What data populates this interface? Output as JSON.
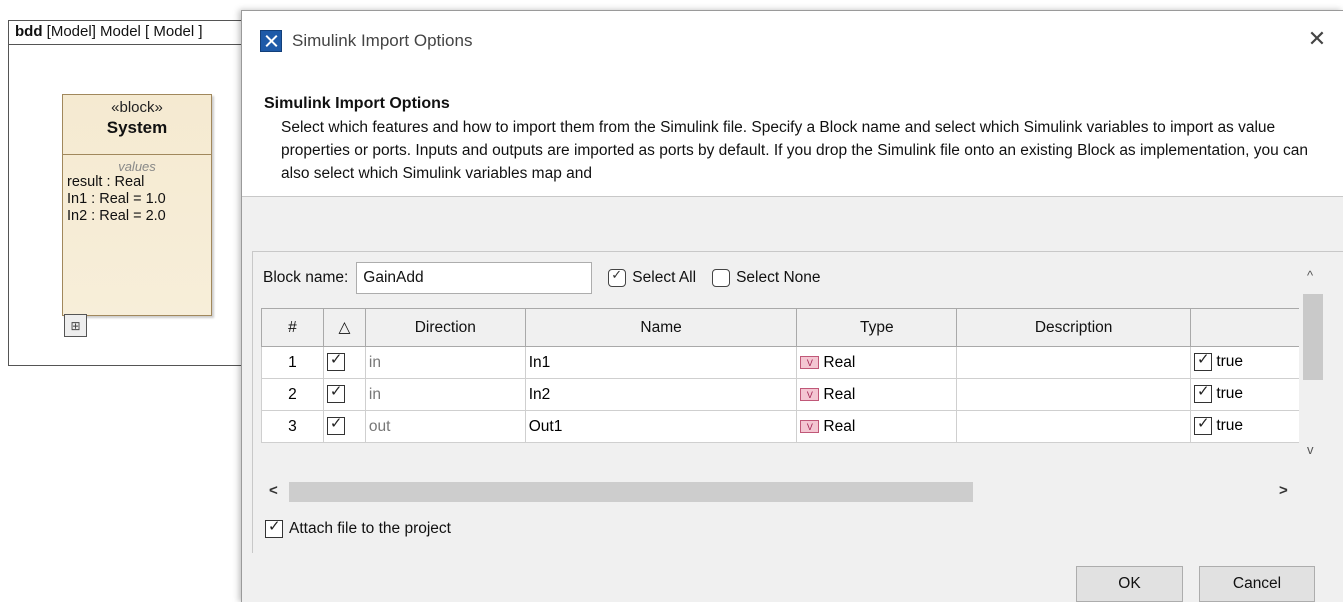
{
  "diagram": {
    "tab_kind": "bdd",
    "tab_rest": " [Model] Model [ Model ]",
    "block": {
      "stereotype": "«block»",
      "name": "System",
      "compartment_title": "values",
      "values": [
        "result : Real",
        "In1 : Real = 1.0",
        "In2 : Real = 2.0"
      ],
      "corner_icon": "⊞"
    }
  },
  "dialog": {
    "title": "Simulink Import Options",
    "close_glyph": "✕",
    "header_title": "Simulink Import Options",
    "header_description": "Select which features and how to import them from the Simulink file. Specify a Block name and select which Simulink variables to import as value properties or ports. Inputs and outputs are imported as ports by default. If you drop the Simulink file onto an existing Block as implementation, you can also select which Simulink variables map and",
    "block_name_label": "Block name:",
    "block_name_value": "GainAdd",
    "select_all_label": "Select All",
    "select_none_label": "Select None",
    "columns": [
      "#",
      "△",
      "Direction",
      "Name",
      "Type",
      "Description",
      ""
    ],
    "rows": [
      {
        "num": "1",
        "checked": true,
        "direction": "in",
        "name": "In1",
        "type": "Real",
        "description": "",
        "flag": "true"
      },
      {
        "num": "2",
        "checked": true,
        "direction": "in",
        "name": "In2",
        "type": "Real",
        "description": "",
        "flag": "true"
      },
      {
        "num": "3",
        "checked": true,
        "direction": "out",
        "name": "Out1",
        "type": "Real",
        "description": "",
        "flag": "true"
      }
    ],
    "type_icon_letter": "V",
    "attach_label": "Attach file to the project",
    "attach_checked": true,
    "ok_label": "OK",
    "cancel_label": "Cancel",
    "scroll_left": "<",
    "scroll_right": ">",
    "scroll_up": "^",
    "scroll_down": "v"
  }
}
